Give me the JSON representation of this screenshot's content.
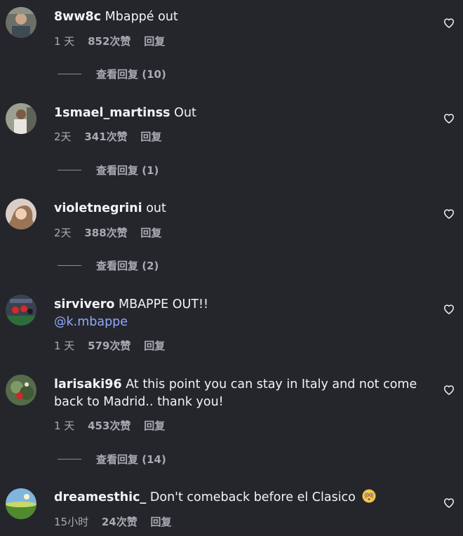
{
  "comments": [
    {
      "username": "8ww8c",
      "text": "Mbappé out",
      "mention": "",
      "time": "1 天",
      "likes": "852次赞",
      "reply": "回复",
      "view_replies": "查看回复 (10)"
    },
    {
      "username": "1smael_martinss",
      "text": "Out",
      "mention": "",
      "time": "2天",
      "likes": "341次赞",
      "reply": "回复",
      "view_replies": "查看回复 (1)"
    },
    {
      "username": "violetnegrini",
      "text": "out",
      "mention": "",
      "time": "2天",
      "likes": "388次赞",
      "reply": "回复",
      "view_replies": "查看回复 (2)"
    },
    {
      "username": "sirvivero",
      "text": "MBAPPE OUT!!",
      "mention": "@k.mbappe",
      "time": "1 天",
      "likes": "579次赞",
      "reply": "回复",
      "view_replies": ""
    },
    {
      "username": "larisaki96",
      "text": "At this point you can stay in Italy and not come back to Madrid.. thank you!",
      "mention": "",
      "time": "1 天",
      "likes": "453次赞",
      "reply": "回复",
      "view_replies": "查看回复 (14)"
    },
    {
      "username": "dreamesthic_",
      "text": "Don't comeback before el Clasico",
      "emoji": "flushed-face-emoji",
      "mention": "",
      "time": "15小时",
      "likes": "24次赞",
      "reply": "回复",
      "view_replies": ""
    }
  ],
  "icons": {
    "like": "heart-outline-icon"
  },
  "colors": {
    "background": "#25262b",
    "text": "#f2f3f5",
    "secondary": "#a8abb2",
    "mention": "#8fa8ff"
  }
}
